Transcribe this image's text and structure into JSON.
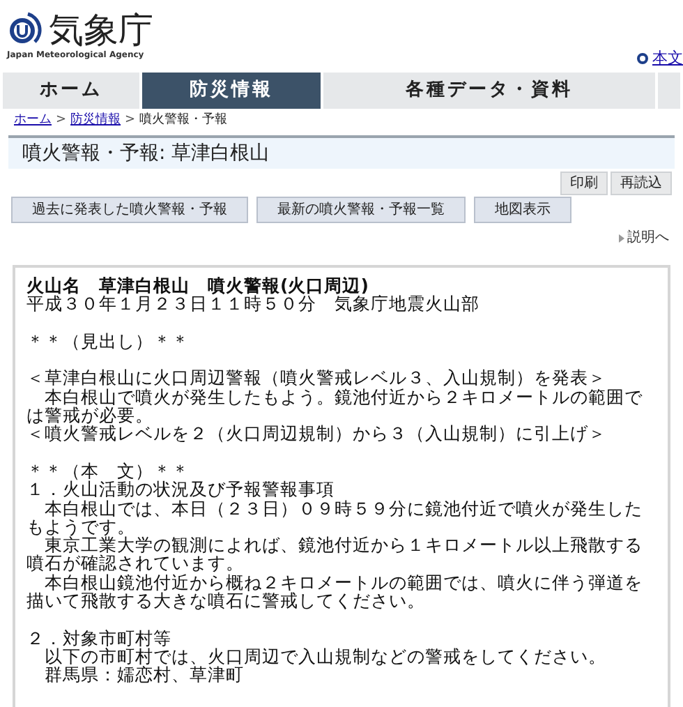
{
  "header": {
    "logo_text": "気象庁",
    "logo_subtext": "Japan Meteorological Agency",
    "skip_link": "本文"
  },
  "nav": [
    {
      "label": "ホーム",
      "selected": false
    },
    {
      "label": "防災情報",
      "selected": true
    },
    {
      "label": "各種データ・資料",
      "selected": false
    }
  ],
  "breadcrumb": {
    "links": [
      "ホーム",
      "防災情報"
    ],
    "separator": ">",
    "current": "噴火警報・予報"
  },
  "page_title": "噴火警報・予報: 草津白根山",
  "tools": [
    "印刷",
    "再読込"
  ],
  "actions": [
    "過去に発表した噴火警報・予報",
    "最新の噴火警報・予報一覧",
    "地図表示"
  ],
  "help_link": "説明へ",
  "bulletin": {
    "title": "火山名　草津白根山　噴火警報(火口周辺)",
    "paragraphs": [
      [
        "平成３０年１月２３日１１時５０分　気象庁地震火山部"
      ],
      [
        "＊＊（見出し）＊＊"
      ],
      [
        "＜草津白根山に火口周辺警報（噴火警戒レベル３、入山規制）を発表＞",
        "　本白根山で噴火が発生したもよう。鏡池付近から２キロメートルの範囲で",
        "は警戒が必要。",
        "＜噴火警戒レベルを２（火口周辺規制）から３（入山規制）に引上げ＞"
      ],
      [
        "＊＊（本　文）＊＊",
        "１．火山活動の状況及び予報警報事項",
        "　本白根山では、本日（２３日）０９時５９分に鏡池付近で噴火が発生した",
        "もようです。",
        "　東京工業大学の観測によれば、鏡池付近から１キロメートル以上飛散する",
        "噴石が確認されています。",
        "　本白根山鏡池付近から概ね２キロメートルの範囲では、噴火に伴う弾道を",
        "描いて飛散する大きな噴石に警戒してください。"
      ],
      [
        "２．対象市町村等",
        "　以下の市町村では、火口周辺で入山規制などの警戒をしてください。",
        "　群馬県：嬬恋村、草津町"
      ]
    ]
  }
}
